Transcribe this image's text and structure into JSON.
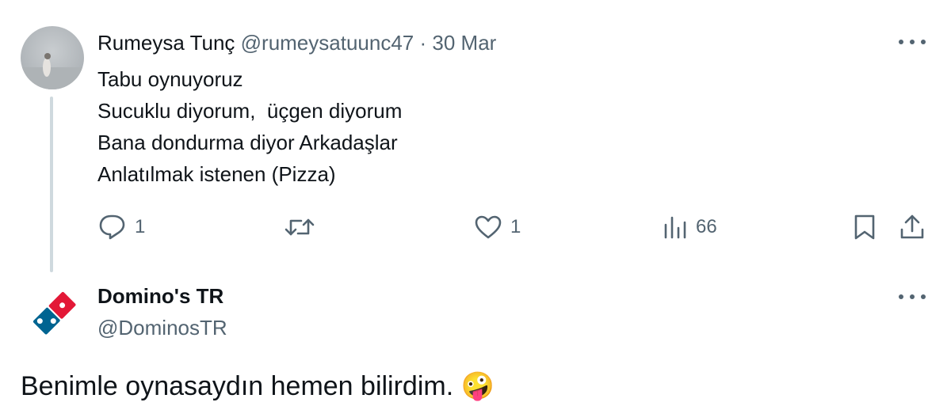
{
  "tweet1": {
    "author_name": "Rumeysa Tunç",
    "handle": "@rumeysatuunc47",
    "separator": "·",
    "date": "30 Mar",
    "lines": [
      "Tabu oynuyoruz",
      "Sucuklu diyorum,  üçgen diyorum",
      "Bana dondurma diyor Arkadaşlar",
      "Anlatılmak istenen (Pizza)"
    ],
    "actions": {
      "reply_count": "1",
      "like_count": "1",
      "view_count": "66"
    },
    "icons": [
      "reply-icon",
      "retweet-icon",
      "heart-icon",
      "views-icon",
      "bookmark-icon",
      "share-icon",
      "more-icon"
    ]
  },
  "tweet2": {
    "author_name": "Domino's TR",
    "handle": "@DominosTR",
    "text": "Benimle oynasaydın hemen bilirdim.",
    "emoji": "🤪",
    "brand_colors": {
      "red": "#e31837",
      "blue": "#006491"
    }
  },
  "colors": {
    "text": "#0f1419",
    "muted": "#536471",
    "thread": "#cfd9de"
  }
}
